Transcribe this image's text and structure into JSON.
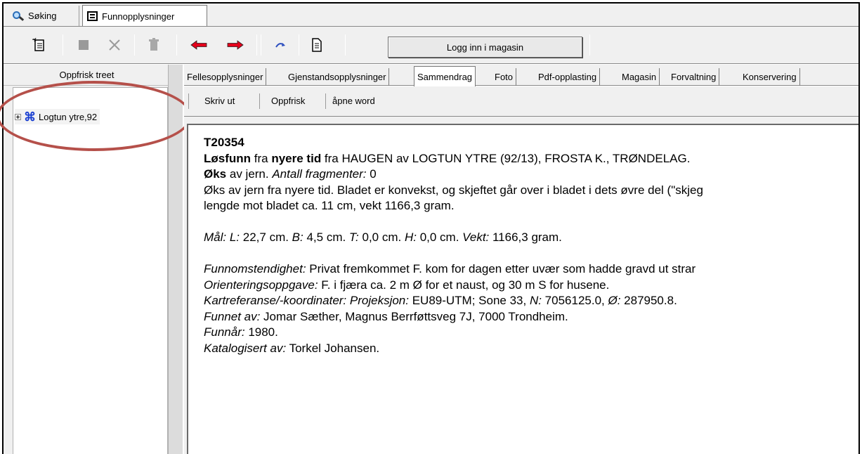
{
  "window_tabs": [
    {
      "label": "Søking",
      "icon": "search-icon",
      "active": false
    },
    {
      "label": "Funnopplysninger",
      "icon": "form-icon",
      "active": true
    }
  ],
  "toolbar": {
    "login_label": "Logg inn i magasin",
    "icons": [
      "new-document-icon",
      "stop-icon",
      "delete-icon",
      "trash-icon",
      "arrow-left-icon",
      "arrow-right-icon",
      "redo-icon",
      "page-icon"
    ],
    "arrow_color": "#e3001b"
  },
  "left": {
    "refresh_label": "Oppfrisk treet",
    "tree_node_label": "Logtun ytre,92",
    "tree_node_icon": "command-icon",
    "highlight_color": "#b5504a"
  },
  "content_tabs": [
    "Fellesopplysninger",
    "Gjenstandsopplysninger",
    "Sammendrag",
    "Foto",
    "Pdf-opplasting",
    "Magasin",
    "Forvaltning",
    "Konservering"
  ],
  "active_tab": "Sammendrag",
  "subtoolbar": {
    "print": "Skriv ut",
    "refresh": "Oppfrisk",
    "open_word": "åpne word"
  },
  "doc": {
    "id": "T20354",
    "l1_b1": "Løsfunn",
    "l1_t1": " fra ",
    "l1_b2": "nyere tid",
    "l1_t2": " fra HAUGEN av LOGTUN YTRE (92/13), FROSTA K., TRØNDELAG.",
    "l2_b": "Øks",
    "l2_t": " av jern. ",
    "l2_i": "Antall fragmenter:",
    "l2_v": " 0",
    "desc1": "Øks av jern fra nyere tid. Bladet er konvekst, og skjeftet går over i bladet i dets øvre del (\"skjeg",
    "desc2": "lengde mot bladet ca. 11 cm, vekt 1166,3 gram.",
    "m_lbl": "Mål: L:",
    "m_l": " 22,7 cm. ",
    "m_b": "B:",
    "m_bv": " 4,5 cm. ",
    "m_t": "T:",
    "m_tv": " 0,0 cm. ",
    "m_h": "H:",
    "m_hv": " 0,0 cm. ",
    "m_w": "Vekt:",
    "m_wv": " 1166,3 gram.",
    "f1_lbl": "Funnomstendighet:",
    "f1_val": " Privat fremkommet F. kom for dagen etter uvær som hadde gravd ut strar",
    "f2_lbl": "Orienteringsoppgave:",
    "f2_val": " F. i fjæra ca. 2 m Ø for et naust, og 30 m S for husene.",
    "f3_lbl": "Kartreferanse/-koordinater: Projeksjon:",
    "f3_v1": " EU89-UTM; Sone 33, ",
    "f3_n": "N:",
    "f3_v2": " 7056125.0, ",
    "f3_o": "Ø:",
    "f3_v3": " 287950.8.",
    "f4_lbl": "Funnet av:",
    "f4_val": " Jomar Sæther, Magnus Berrføttsveg 7J, 7000 Trondheim.",
    "f5_lbl": "Funnår:",
    "f5_val": " 1980.",
    "f6_lbl": "Katalogisert av:",
    "f6_val": " Torkel Johansen."
  }
}
